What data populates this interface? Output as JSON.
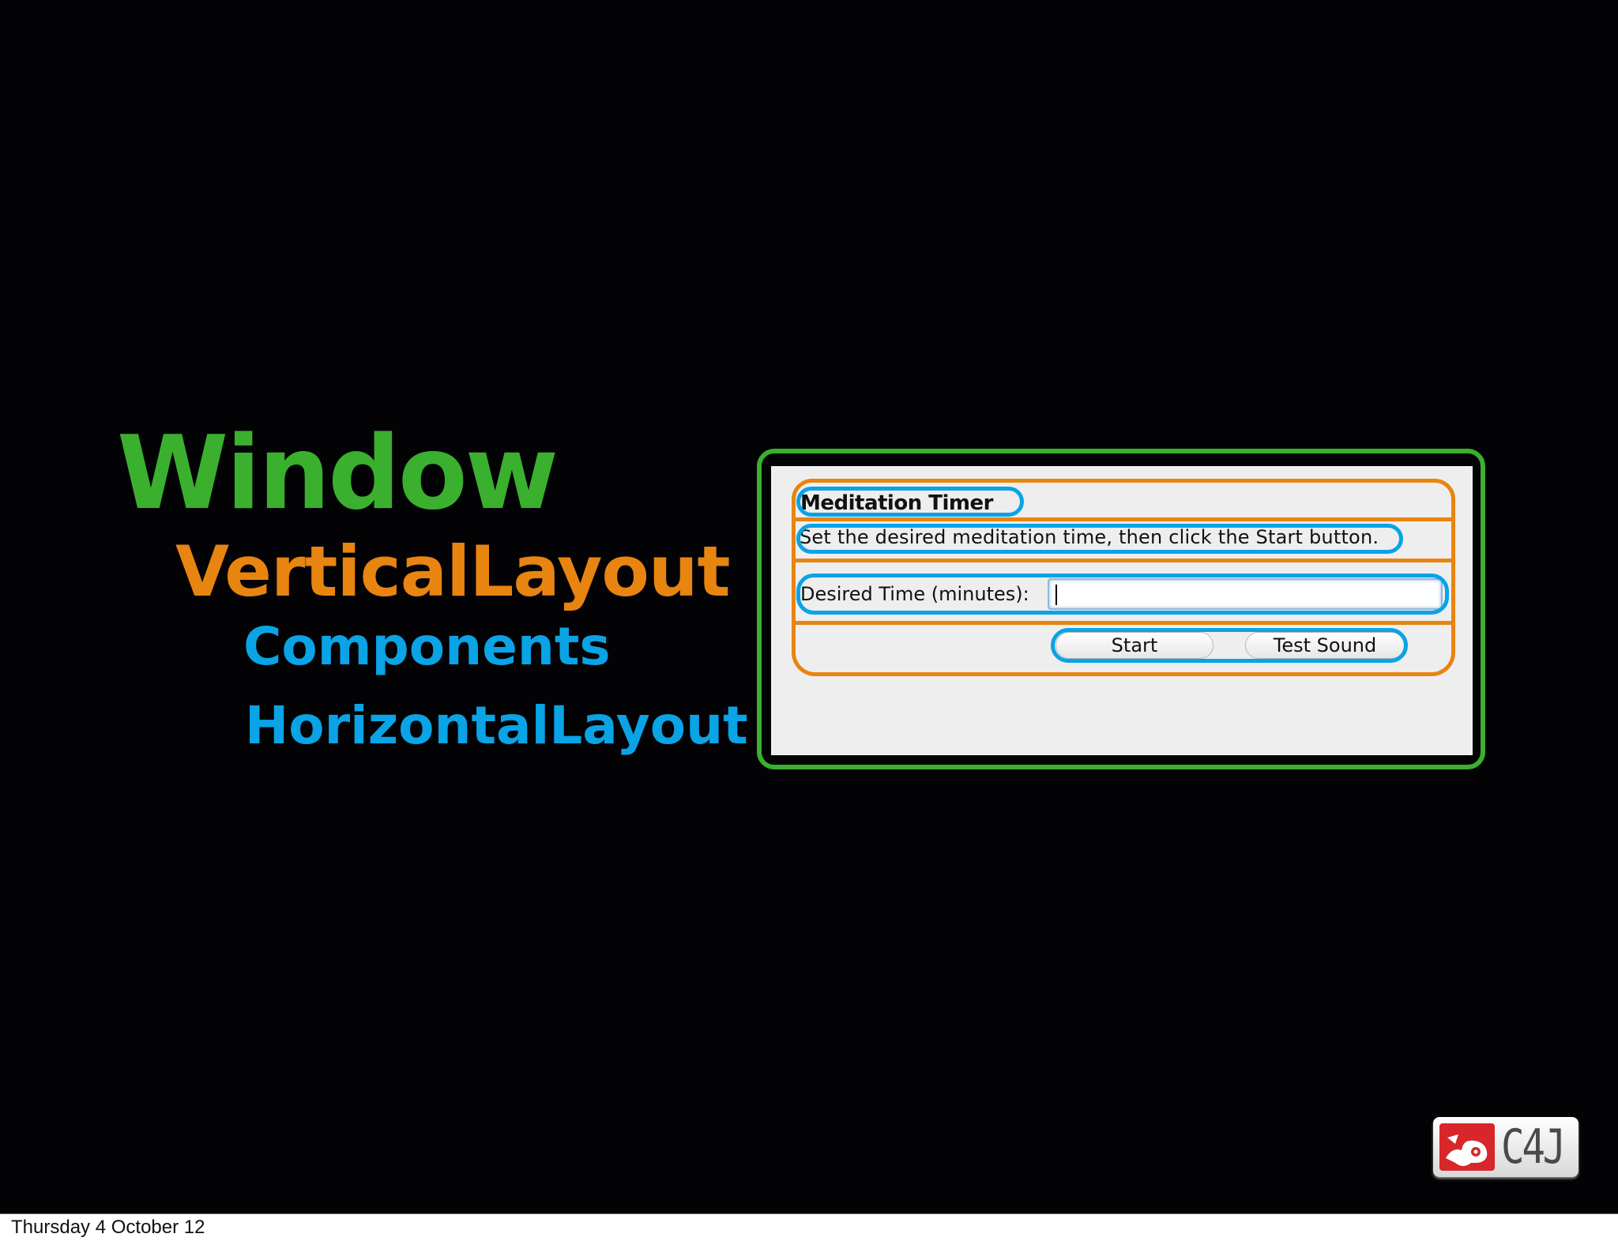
{
  "colors": {
    "slide_background": "#030305",
    "window": "#3ab02e",
    "vertical_layout": "#e88410",
    "components": "#0aa3e6",
    "horizontal_layout": "#0aa3e6"
  },
  "legend": {
    "window": "Window",
    "vertical_layout": "VerticalLayout",
    "components": "Components",
    "horizontal_layout": "HorizontalLayout"
  },
  "app": {
    "title": "Meditation Timer",
    "instructions": "Set the desired meditation time, then click the Start button.",
    "time_label": "Desired Time (minutes):",
    "time_value": "",
    "start_label": "Start",
    "test_sound_label": "Test Sound"
  },
  "logo": {
    "text": "C4J"
  },
  "footer": {
    "date": "Thursday 4 October 12"
  }
}
